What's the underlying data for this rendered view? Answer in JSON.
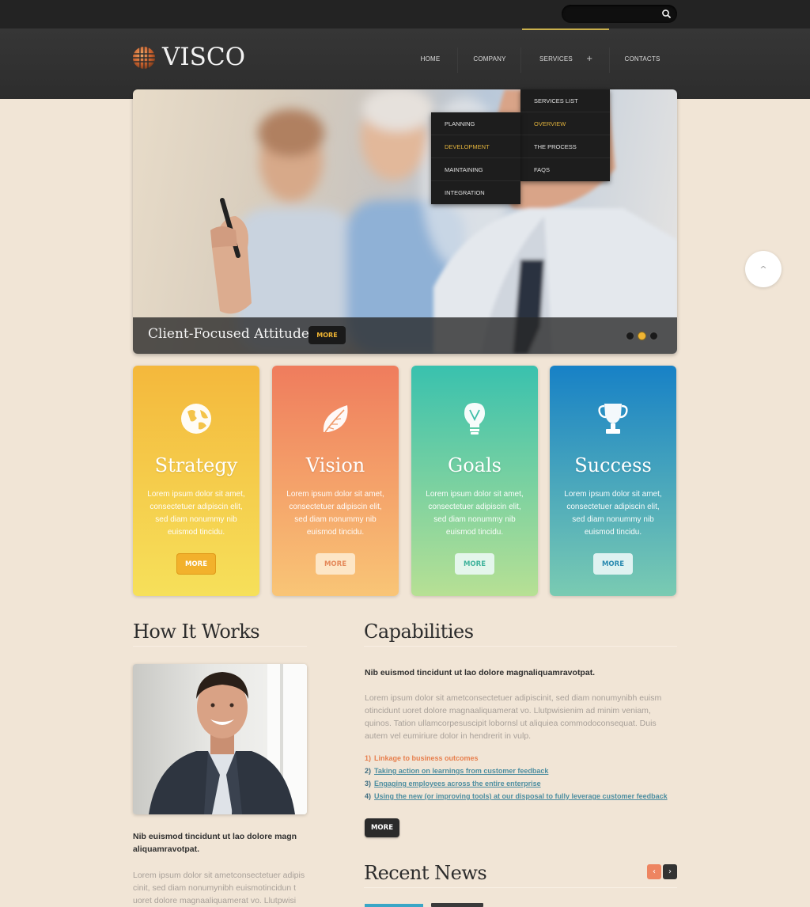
{
  "search": {
    "placeholder": "",
    "value": ""
  },
  "brand": {
    "name": "VISCO"
  },
  "nav": {
    "items": [
      {
        "label": "HOME"
      },
      {
        "label": "COMPANY"
      },
      {
        "label": "SERVICES",
        "plus": "+"
      },
      {
        "label": "CONTACTS"
      }
    ],
    "services_menu": [
      "SERVICES LIST",
      "OVERVIEW",
      "THE PROCESS",
      "FAQS"
    ],
    "sub_menu": [
      "PLANNING",
      "DEVELOPMENT",
      "MAINTAINING",
      "INTEGRATION"
    ]
  },
  "hero": {
    "title": "Client-Focused Attitude",
    "more_label": "MORE",
    "slide_count": 3,
    "active_slide": 2
  },
  "scroll_top": {
    "icon": "chevron-up-icon",
    "glyph": "^"
  },
  "cards": [
    {
      "title": "Strategy",
      "text": "Lorem ipsum dolor sit amet, consectetuer adipiscin elit, sed diam nonummy nib euismod tincidu.",
      "more": "MORE",
      "icon": "globe-icon",
      "color_top": "#f4b63a",
      "color_bottom": "#f4de56"
    },
    {
      "title": "Vision",
      "text": "Lorem ipsum dolor sit amet, consectetuer adipiscin elit, sed diam nonummy nib euismod tincidu.",
      "more": "MORE",
      "icon": "leaf-icon",
      "color_top": "#ef7f5c",
      "color_bottom": "#f8c174"
    },
    {
      "title": "Goals",
      "text": "Lorem ipsum dolor sit amet, consectetuer adipiscin elit, sed diam nonummy nib euismod tincidu.",
      "more": "MORE",
      "icon": "lightbulb-icon",
      "color_top": "#39c0ad",
      "color_bottom": "#b4df93"
    },
    {
      "title": "Success",
      "text": "Lorem ipsum dolor sit amet, consectetuer adipiscin elit, sed diam nonummy nib euismod tincidu.",
      "more": "MORE",
      "icon": "trophy-icon",
      "color_top": "#1781c6",
      "color_bottom": "#74c9b3"
    }
  ],
  "how_it_works": {
    "title": "How It Works",
    "bold": "Nib euismod tincidunt ut lao dolore magn aliquamravotpat.",
    "text": "Lorem ipsum dolor sit ametconsectetuer adipis cinit, sed diam nonumynibh euismotincidun t uoret dolore magnaaliquamerat vo. Llutpwisi"
  },
  "capabilities": {
    "title": "Capabilities",
    "bold": "Nib euismod tincidunt ut lao dolore magnaliquamravotpat.",
    "text": "Lorem ipsum dolor sit ametconsectetuer adipiscinit, sed diam nonumynibh euism otincidunt uoret dolore magnaaliquamerat vo. Llutpwisienim ad minim veniam, quinos. Tation ullamcorpesuscipit lobornsl ut aliquiea commodoconsequat. Duis autem vel eumiriure dolor in hendrerit in vulp.",
    "list": [
      {
        "num": "1)",
        "text": "Linkage to business outcomes"
      },
      {
        "num": "2)",
        "text": "Taking action on learnings from customer feedback"
      },
      {
        "num": "3)",
        "text": "Engaging employees across the entire enterprise"
      },
      {
        "num": "4)",
        "text": "Using the new (or improving tools) at our disposal to fully leverage customer feedback"
      }
    ],
    "more": "MORE"
  },
  "recent_news": {
    "title": "Recent News",
    "prev": "‹",
    "next": "›"
  },
  "colors": {
    "accent_gold": "#f0b533",
    "header_dark": "#2d2d2d",
    "bg": "#f1e5d6",
    "link_teal": "#4d8ea0",
    "link_orange": "#e77f4d"
  }
}
